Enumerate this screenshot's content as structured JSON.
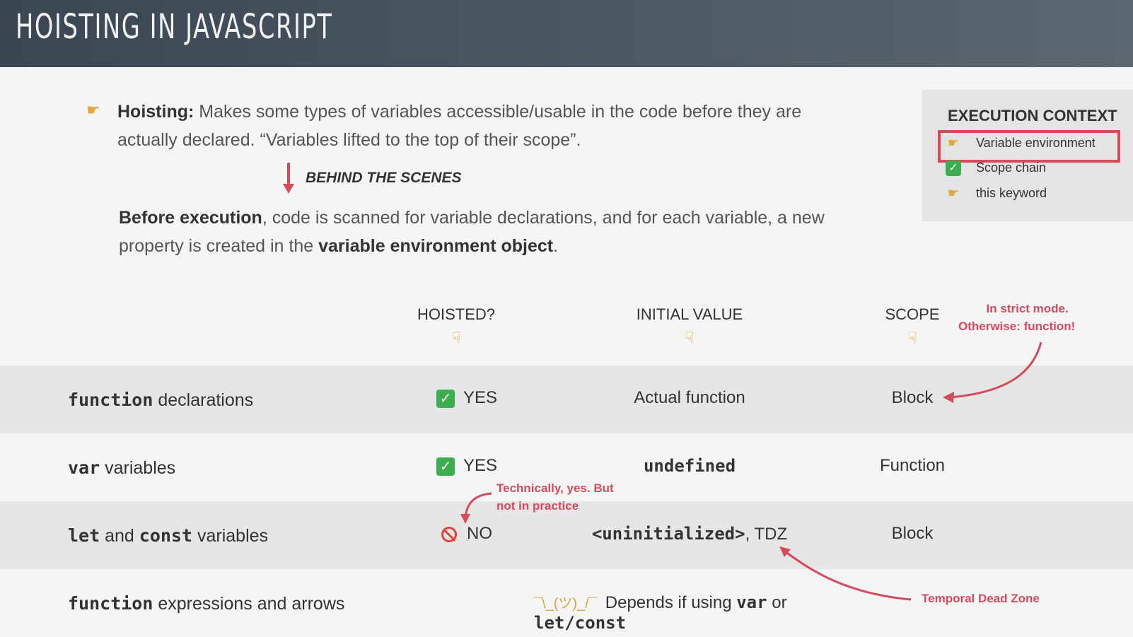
{
  "header": {
    "title": "HOISTING IN JAVASCRIPT"
  },
  "intro": {
    "hoisting_label": "Hoisting:",
    "hoisting_text_1": "Makes some types of variables accessible/usable in the code before they are",
    "hoisting_text_2": "actually declared. “Variables lifted to the top of their scope”.",
    "behind_label": "BEHIND THE SCENES",
    "before_bold": "Before execution",
    "before_text_1": ", code is scanned for variable declarations, and for each variable, a new",
    "before_text_2a": "property is created in the ",
    "before_bold_2": "variable environment object",
    "before_text_2b": "."
  },
  "execution_context": {
    "title": "EXECUTION CONTEXT",
    "items": [
      {
        "icon": "pointing-hand-icon",
        "label": "Variable environment"
      },
      {
        "icon": "check-icon",
        "label": "Scope chain"
      },
      {
        "icon": "pointing-hand-icon",
        "label": "this keyword"
      }
    ]
  },
  "table": {
    "columns": [
      "HOISTED?",
      "INITIAL VALUE",
      "SCOPE"
    ],
    "rows": [
      {
        "label_code": "function",
        "label_text": " declarations",
        "hoisted": "YES",
        "hoisted_icon": "check-icon",
        "initial": "Actual function",
        "scope": "Block"
      },
      {
        "label_code": "var",
        "label_text": " variables",
        "hoisted": "YES",
        "hoisted_icon": "check-icon",
        "initial": "undefined",
        "scope": "Function"
      },
      {
        "label_code_1": "let",
        "label_mid": " and ",
        "label_code_2": "const",
        "label_text": " variables",
        "hoisted": "NO",
        "hoisted_icon": "no-entry-icon",
        "initial_code": "<uninitialized>",
        "initial_text": ", TDZ",
        "scope": "Block"
      },
      {
        "label_code": "function",
        "label_text": " expressions and arrows",
        "depends_text": "Depends if using ",
        "depends_code_1": "var",
        "depends_or": " or ",
        "depends_code_2": "let/const"
      }
    ]
  },
  "notes": {
    "strict_1": "In strict mode.",
    "strict_2": "Otherwise: function!",
    "technically_1": "Technically, yes. But",
    "technically_2": "not in practice",
    "tdz": "Temporal Dead Zone"
  },
  "colors": {
    "accent": "#d64a5c",
    "header": "#3a4652",
    "check": "#3cae50"
  }
}
